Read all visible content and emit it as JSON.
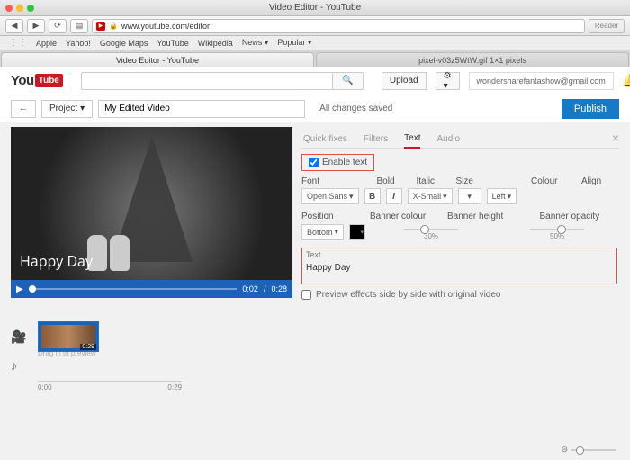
{
  "os": {
    "title": "Video Editor - YouTube"
  },
  "browser": {
    "url": "www.youtube.com/editor",
    "reader": "Reader",
    "bookmarks": [
      "Apple",
      "Yahoo!",
      "Google Maps",
      "YouTube",
      "Wikipedia",
      "News ▾",
      "Popular ▾"
    ],
    "tabs": [
      {
        "label": "Video Editor - YouTube",
        "active": true
      },
      {
        "label": "pixel-v03z5WtW.gif 1×1 pixels",
        "active": false
      }
    ]
  },
  "header": {
    "logo_you": "You",
    "logo_tube": "Tube",
    "upload": "Upload",
    "user": "wondersharefantashow@gmail.com",
    "search_placeholder": ""
  },
  "projectBar": {
    "back": "←",
    "project_btn": "Project",
    "title": "My Edited Video",
    "status": "All changes saved",
    "publish": "Publish"
  },
  "video": {
    "overlay_text": "Happy Day",
    "current": "0:02",
    "duration": "0:28"
  },
  "panel": {
    "tabs": [
      "Quick fixes",
      "Filters",
      "Text",
      "Audio"
    ],
    "activeTab": "Text",
    "enable_label": "Enable text",
    "labels": {
      "font": "Font",
      "bold": "Bold",
      "italic": "Italic",
      "size": "Size",
      "colour": "Colour",
      "align": "Align",
      "position": "Position",
      "banner_colour": "Banner colour",
      "banner_height": "Banner height",
      "banner_opacity": "Banner opacity",
      "text": "Text"
    },
    "values": {
      "font": "Open Sans",
      "size": "X-Small",
      "align": "Left",
      "position": "Bottom",
      "banner_height": "30%",
      "banner_opacity": "50%",
      "text": "Happy Day"
    },
    "preview_label": "Preview effects side by side with original video"
  },
  "timeline": {
    "clip_time": "0:29",
    "hint": "Drag in to preview",
    "ruler_start": "0:00",
    "ruler_end": "0:29"
  },
  "zoom": {
    "label": "⊖"
  }
}
